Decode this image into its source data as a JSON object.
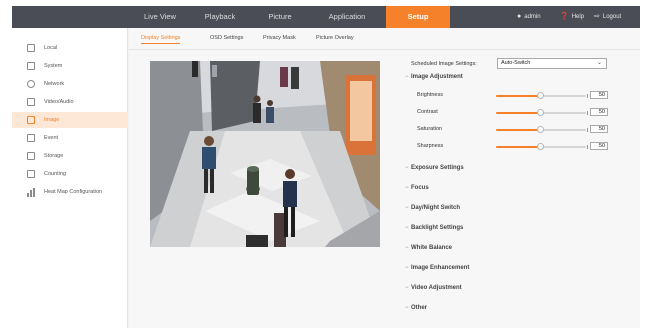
{
  "topnav": {
    "items": [
      {
        "label": "Live View"
      },
      {
        "label": "Playback"
      },
      {
        "label": "Picture"
      },
      {
        "label": "Application"
      },
      {
        "label": "Setup"
      }
    ],
    "active_index": 4,
    "user": "admin",
    "help": "Help",
    "logout": "Logout"
  },
  "sidebar": {
    "items": [
      {
        "label": "Local",
        "icon": "monitor-icon"
      },
      {
        "label": "System",
        "icon": "system-icon"
      },
      {
        "label": "Network",
        "icon": "globe-icon"
      },
      {
        "label": "Video/Audio",
        "icon": "video-audio-icon"
      },
      {
        "label": "Image",
        "icon": "image-icon"
      },
      {
        "label": "Event",
        "icon": "event-icon"
      },
      {
        "label": "Storage",
        "icon": "storage-icon"
      },
      {
        "label": "Counting",
        "icon": "counting-icon"
      },
      {
        "label": "Heat Map Configuration",
        "icon": "heatmap-icon"
      }
    ],
    "active_index": 4
  },
  "tabs": [
    {
      "label": "Display Settings"
    },
    {
      "label": "OSD Settings"
    },
    {
      "label": "Privacy Mask"
    },
    {
      "label": "Picture Overlay"
    }
  ],
  "active_tab": 0,
  "settings": {
    "scheduled_label": "Scheduled Image Settings",
    "scheduled_value": "Auto-Switch",
    "image_adjustment": {
      "title": "Image Adjustment",
      "sliders": [
        {
          "label": "Brightness",
          "value": "50",
          "level": 0.5
        },
        {
          "label": "Contrast",
          "value": "50",
          "level": 0.5
        },
        {
          "label": "Saturation",
          "value": "50",
          "level": 0.5
        },
        {
          "label": "Sharpness",
          "value": "50",
          "level": 0.5
        }
      ]
    },
    "sections": [
      {
        "label": "Exposure Settings"
      },
      {
        "label": "Focus"
      },
      {
        "label": "Day/Night Switch"
      },
      {
        "label": "Backlight Settings"
      },
      {
        "label": "White Balance"
      },
      {
        "label": "Image Enhancement"
      },
      {
        "label": "Video Adjustment"
      },
      {
        "label": "Other"
      }
    ]
  },
  "colors": {
    "accent": "#f5822a",
    "topbar": "#4a4d55"
  }
}
